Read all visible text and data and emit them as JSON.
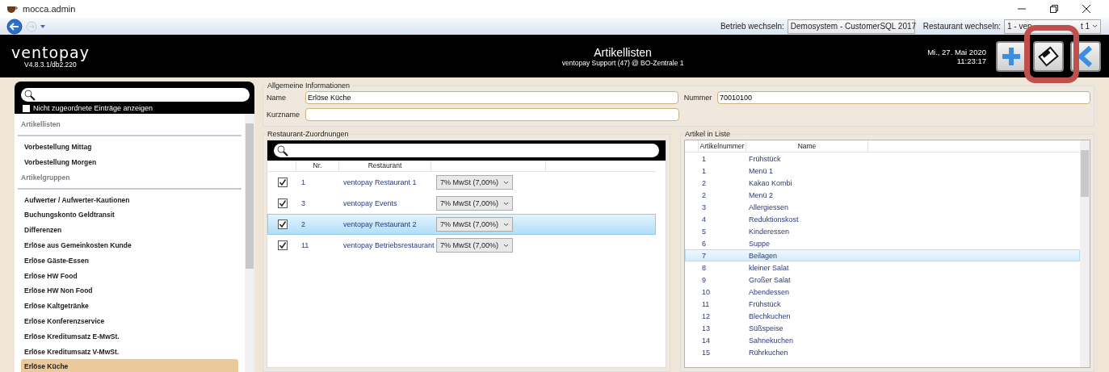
{
  "window": {
    "title": "mocca.admin"
  },
  "toolbar": {
    "betrieb_label": "Betrieb wechseln:",
    "betrieb_value": "Demosystem - CustomerSQL 2017",
    "restaurant_label": "Restaurant wechseln:",
    "restaurant_value_parts": [
      "1 - ven",
      "t 1"
    ]
  },
  "header": {
    "logo": "ventopay",
    "version": "V4.8.3.1/db2.220",
    "title": "Artikellisten",
    "subtitle": "ventopay Support (47) @ BO-Zentrale 1",
    "date": "Mi., 27. Mai 2020",
    "time": "11:23:17"
  },
  "sidebar": {
    "filter_label": "Nicht zugeordnete Einträge anzeigen",
    "filter_checked": false,
    "items": [
      {
        "kind": "header",
        "label": "Artikellisten"
      },
      {
        "kind": "item",
        "label": "Vorbestellung Mittag",
        "selected": false
      },
      {
        "kind": "item",
        "label": "Vorbestellung Morgen",
        "selected": false
      },
      {
        "kind": "header",
        "label": "Artikelgruppen"
      },
      {
        "kind": "item",
        "label": "Aufwerter / Aufwerter-Kautionen",
        "selected": false
      },
      {
        "kind": "item",
        "label": "Buchungskonto Geldtransit",
        "selected": false
      },
      {
        "kind": "item",
        "label": "Differenzen",
        "selected": false
      },
      {
        "kind": "item",
        "label": "Erlöse aus Gemeinkosten Kunde",
        "selected": false
      },
      {
        "kind": "item",
        "label": "Erlöse Gäste-Essen",
        "selected": false
      },
      {
        "kind": "item",
        "label": "Erlöse HW Food",
        "selected": false
      },
      {
        "kind": "item",
        "label": "Erlöse HW Non Food",
        "selected": false
      },
      {
        "kind": "item",
        "label": "Erlöse Kaltgetränke",
        "selected": false
      },
      {
        "kind": "item",
        "label": "Erlöse Konferenzservice",
        "selected": false
      },
      {
        "kind": "item",
        "label": "Erlöse Kreditumsatz E-MwSt.",
        "selected": false
      },
      {
        "kind": "item",
        "label": "Erlöse Kreditumsatz V-MwSt.",
        "selected": false
      },
      {
        "kind": "item",
        "label": "Erlöse Küche",
        "selected": true
      }
    ]
  },
  "general": {
    "title": "Allgemeine Informationen",
    "name_label": "Name",
    "name_value": "Erlöse Küche",
    "nummer_label": "Nummer",
    "nummer_value": "70010100",
    "kurzname_label": "Kurzname"
  },
  "restaurants": {
    "title": "Restaurant-Zuordnungen",
    "columns": [
      "Nr.",
      "Restaurant"
    ],
    "rows": [
      {
        "checked": true,
        "nr": "1",
        "name": "ventopay Restaurant 1",
        "tax": "7% MwSt (7,00%)",
        "selected": false
      },
      {
        "checked": true,
        "nr": "3",
        "name": "ventopay Events",
        "tax": "7% MwSt (7,00%)",
        "selected": false
      },
      {
        "checked": true,
        "nr": "2",
        "name": "ventopay Restaurant 2",
        "tax": "7% MwSt (7,00%)",
        "selected": true
      },
      {
        "checked": true,
        "nr": "11",
        "name": "ventopay Betriebsrestaurant",
        "tax": "7% MwSt (7,00%)",
        "selected": false
      }
    ]
  },
  "articles": {
    "title": "Artikel in Liste",
    "columns": [
      "Artikelnummer",
      "Name"
    ],
    "rows": [
      {
        "nr": "1",
        "name": "Frühstück",
        "selected": false
      },
      {
        "nr": "1",
        "name": "Menü 1",
        "selected": false
      },
      {
        "nr": "2",
        "name": "Kakao Kombi",
        "selected": false
      },
      {
        "nr": "2",
        "name": "Menü 2",
        "selected": false
      },
      {
        "nr": "3",
        "name": "Allergiessen",
        "selected": false
      },
      {
        "nr": "4",
        "name": "Reduktionskost",
        "selected": false
      },
      {
        "nr": "5",
        "name": "Kinderessen",
        "selected": false
      },
      {
        "nr": "6",
        "name": "Suppe",
        "selected": false
      },
      {
        "nr": "7",
        "name": "Beilagen",
        "selected": true
      },
      {
        "nr": "8",
        "name": "kleiner Salat",
        "selected": false
      },
      {
        "nr": "9",
        "name": "Großer Salat",
        "selected": false
      },
      {
        "nr": "10",
        "name": "Abendessen",
        "selected": false
      },
      {
        "nr": "11",
        "name": "Frühstück",
        "selected": false
      },
      {
        "nr": "12",
        "name": "Blechkuchen",
        "selected": false
      },
      {
        "nr": "13",
        "name": "Süßspeise",
        "selected": false
      },
      {
        "nr": "14",
        "name": "Sahnekuchen",
        "selected": false
      },
      {
        "nr": "15",
        "name": "Rührkuchen",
        "selected": false
      }
    ]
  }
}
